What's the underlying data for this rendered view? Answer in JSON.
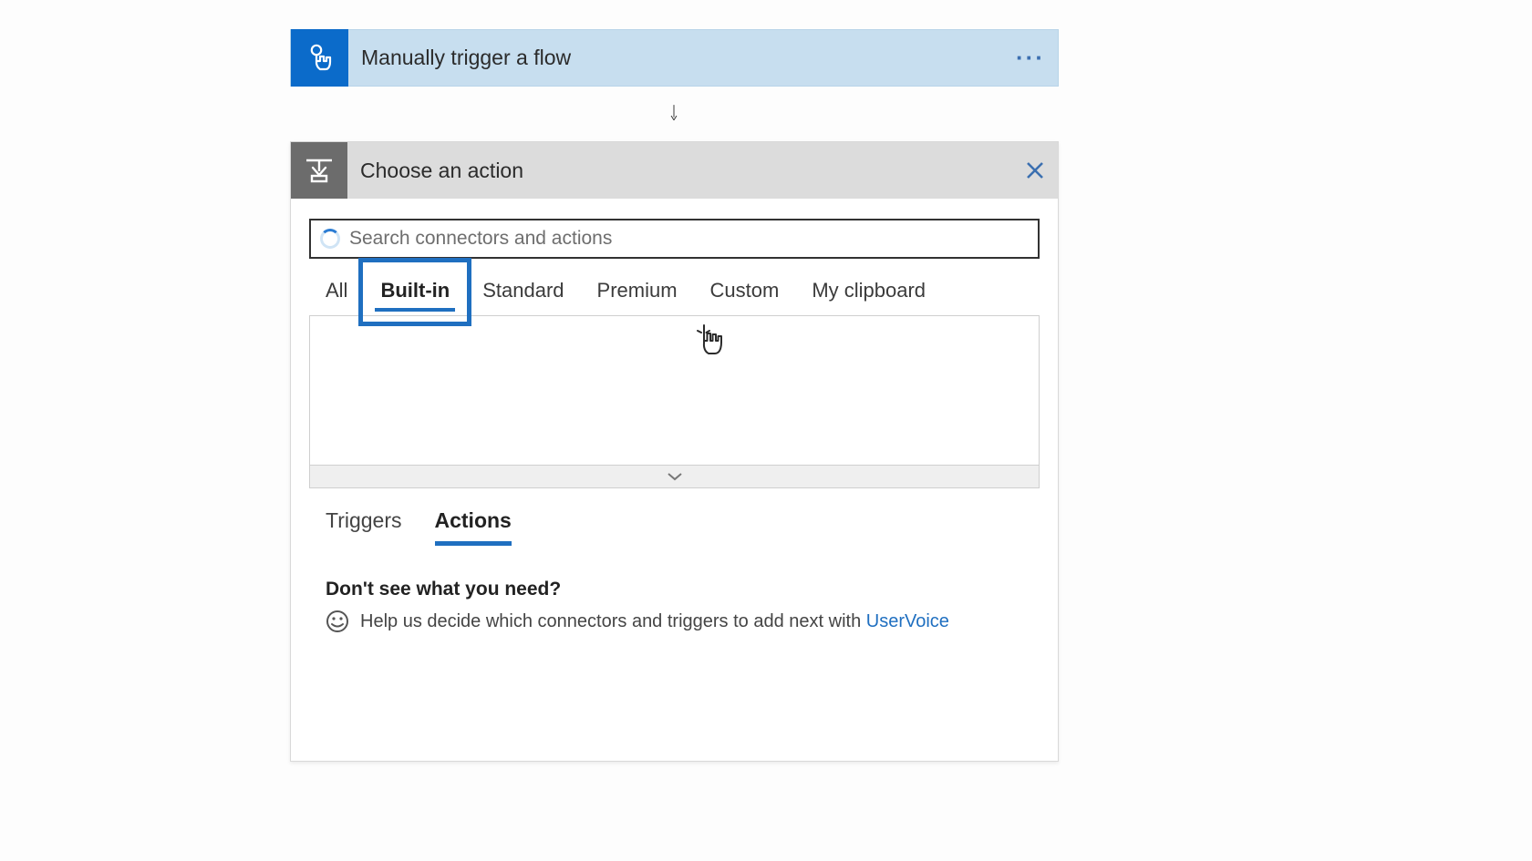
{
  "trigger": {
    "title": "Manually trigger a flow",
    "more_label": "···"
  },
  "action_panel": {
    "title": "Choose an action",
    "close_label": "×"
  },
  "search": {
    "placeholder": "Search connectors and actions"
  },
  "filters": {
    "all": "All",
    "builtin": "Built-in",
    "standard": "Standard",
    "premium": "Premium",
    "custom": "Custom",
    "clipboard": "My clipboard"
  },
  "sub_tabs": {
    "triggers": "Triggers",
    "actions": "Actions"
  },
  "feedback": {
    "title": "Don't see what you need?",
    "text": "Help us decide which connectors and triggers to add next with ",
    "link": "UserVoice"
  }
}
